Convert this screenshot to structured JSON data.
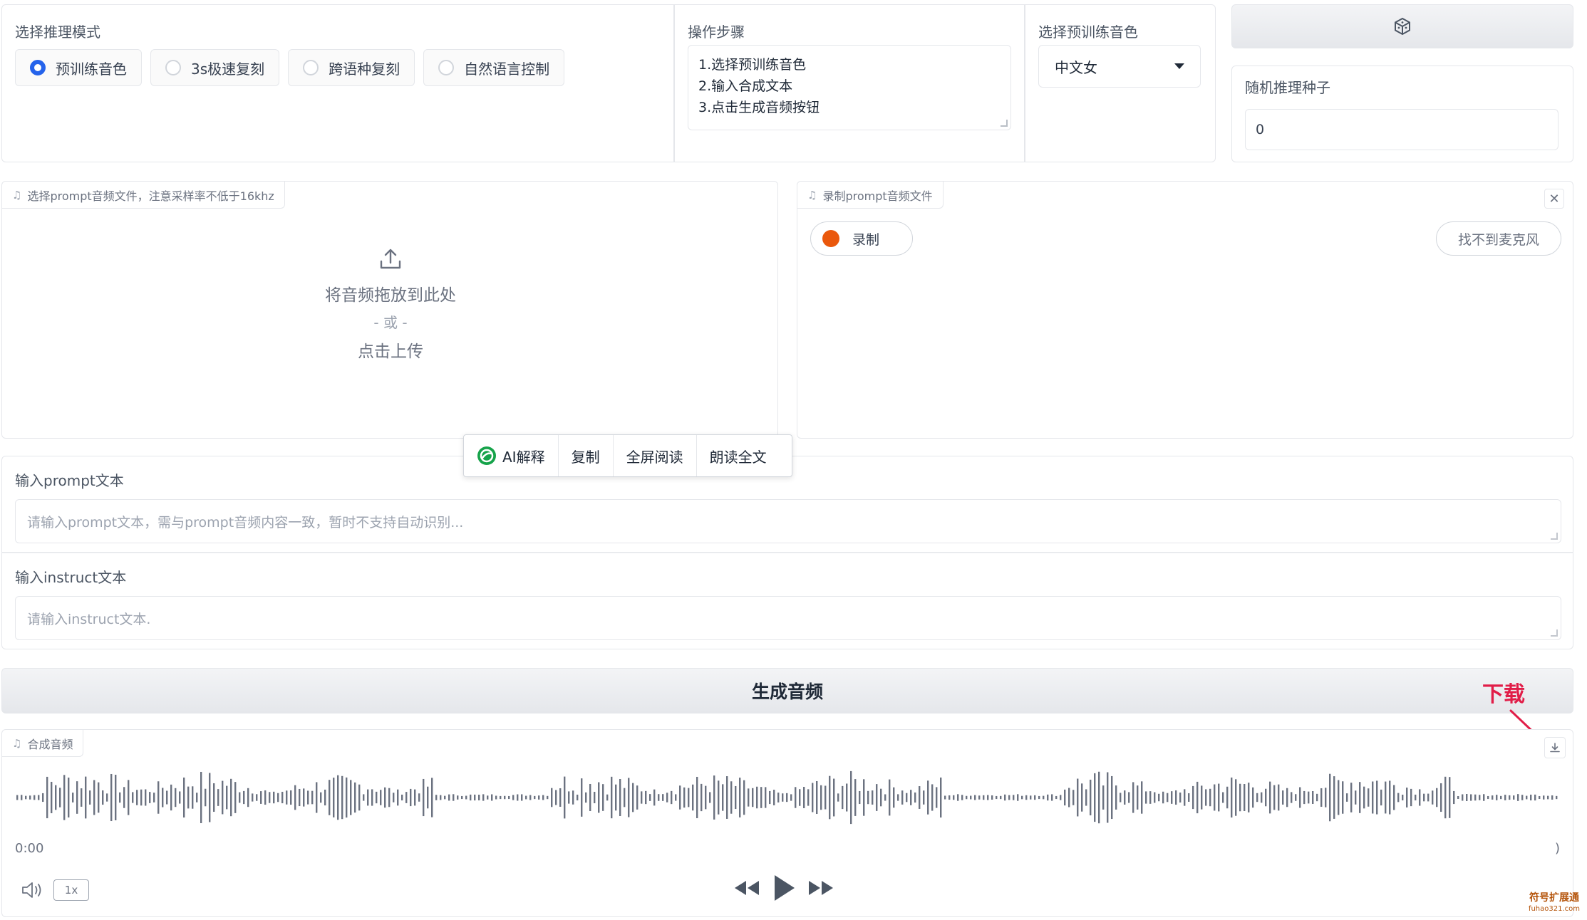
{
  "mode": {
    "label": "选择推理模式",
    "options": [
      "预训练音色",
      "3s极速复刻",
      "跨语种复刻",
      "自然语言控制"
    ],
    "selected_index": 0
  },
  "steps": {
    "label": "操作步骤",
    "lines": [
      "1.选择预训练音色",
      "2.输入合成文本",
      "3.点击生成音频按钮"
    ]
  },
  "voice": {
    "label": "选择预训练音色",
    "value": "中文女"
  },
  "seed": {
    "label": "随机推理种子",
    "value": "0",
    "button_icon": "dice-icon"
  },
  "upload": {
    "tag": "选择prompt音频文件，注意采样率不低于16khz",
    "drop_text": "将音频拖放到此处",
    "or_text": "- 或 -",
    "click_text": "点击上传"
  },
  "record": {
    "tag": "录制prompt音频文件",
    "record_label": "录制",
    "mic_label": "找不到麦克风"
  },
  "float_toolbar": {
    "items": [
      "AI解释",
      "复制",
      "全屏阅读",
      "朗读全文"
    ]
  },
  "prompt_text": {
    "label": "输入prompt文本",
    "placeholder": "请输入prompt文本，需与prompt音频内容一致，暂时不支持自动识别..."
  },
  "instruct_text": {
    "label": "输入instruct文本",
    "placeholder": "请输入instruct文本."
  },
  "generate": {
    "label": "生成音频"
  },
  "annotation": {
    "download_note": "下载",
    "color": "#e11d48"
  },
  "output": {
    "tag": "合成音频",
    "time_current": "0:00",
    "time_total": ")",
    "rate": "1x"
  },
  "watermark": {
    "line1": "符号扩展通",
    "line2": "fuhao321.com"
  },
  "colors": {
    "accent": "#2563eb",
    "record_dot": "#ea580c",
    "ai_icon": "#16a34a"
  }
}
